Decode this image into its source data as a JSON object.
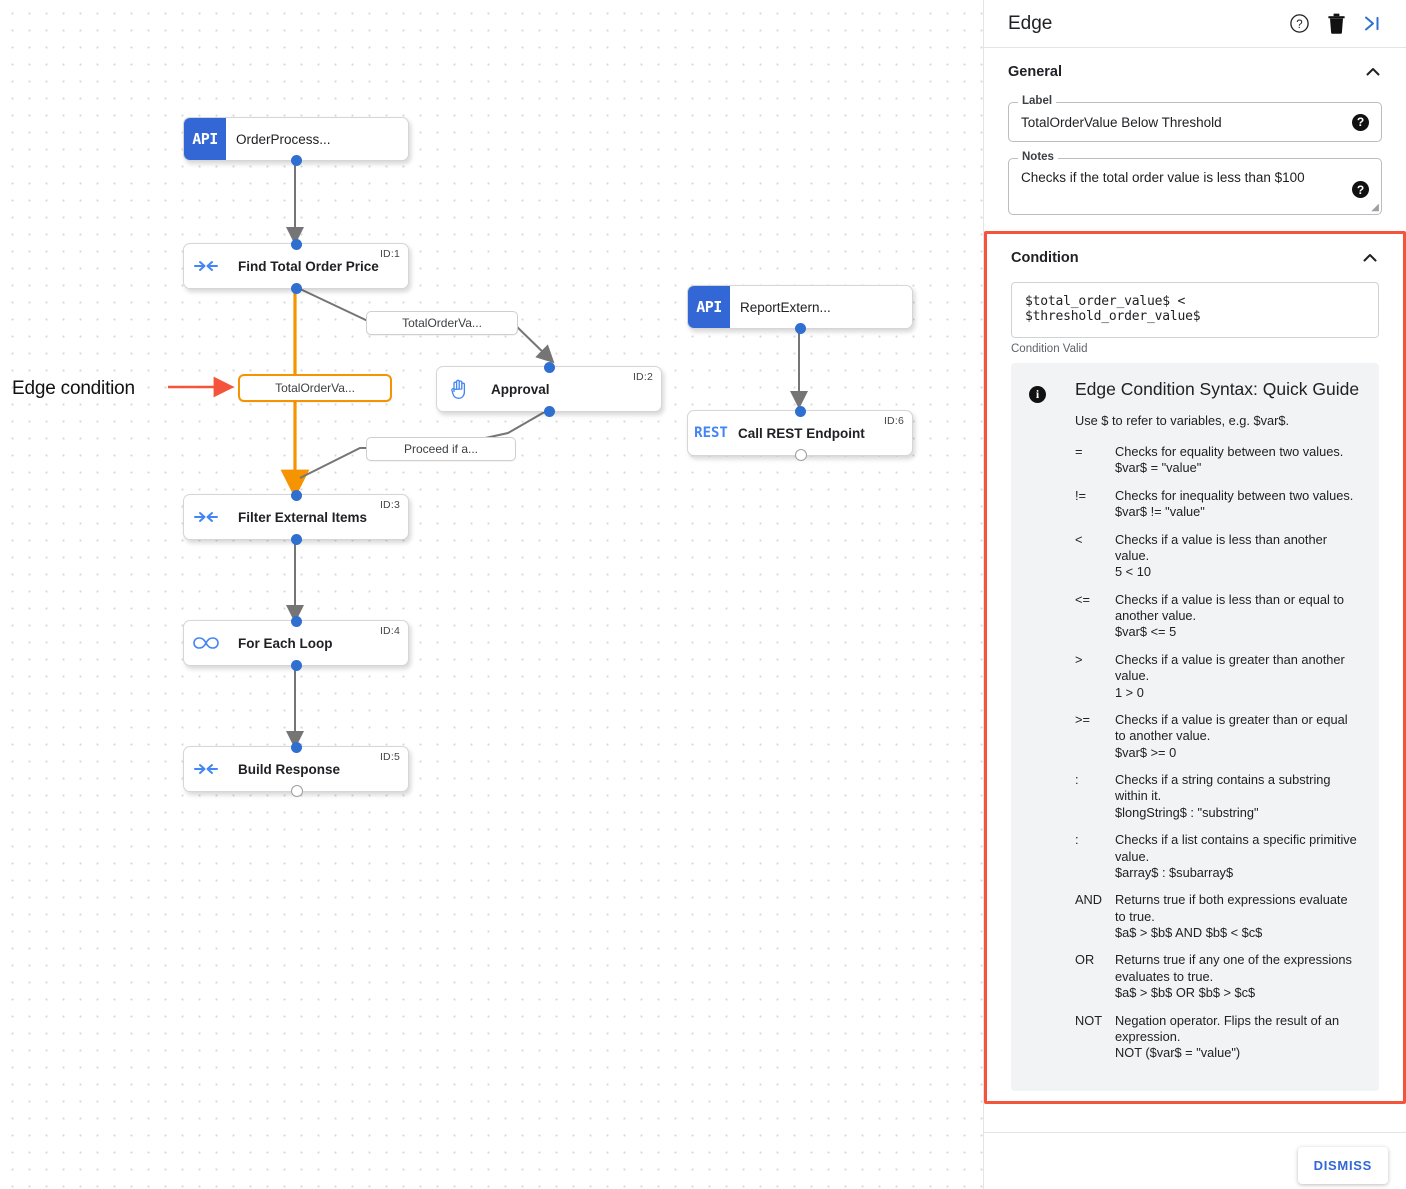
{
  "canvas": {
    "annotation": {
      "label": "Edge condition"
    },
    "nodes": [
      {
        "id": "",
        "badge": "API",
        "label": "OrderProcess...",
        "icon": "api-badge-icon",
        "type": "api"
      },
      {
        "id": "ID:1",
        "badge": "",
        "label": "Find Total Order Price",
        "icon": "merge-arrows-icon",
        "type": "step"
      },
      {
        "id": "ID:2",
        "badge": "",
        "label": "Approval",
        "icon": "hand-icon",
        "type": "step"
      },
      {
        "id": "ID:3",
        "badge": "",
        "label": "Filter External Items",
        "icon": "merge-arrows-icon",
        "type": "step"
      },
      {
        "id": "ID:4",
        "badge": "",
        "label": "For Each Loop",
        "icon": "infinity-icon",
        "type": "step"
      },
      {
        "id": "ID:5",
        "badge": "",
        "label": "Build Response",
        "icon": "merge-arrows-icon",
        "type": "step"
      },
      {
        "id": "",
        "badge": "API",
        "label": "ReportExtern...",
        "icon": "api-badge-icon",
        "type": "api"
      },
      {
        "id": "ID:6",
        "badge": "REST",
        "label": "Call REST Endpoint",
        "icon": "rest-badge-icon",
        "type": "rest"
      }
    ],
    "edge_labels": [
      {
        "text": "TotalOrderVa...",
        "selected": false
      },
      {
        "text": "TotalOrderVa...",
        "selected": true
      },
      {
        "text": "Proceed if a...",
        "selected": false
      }
    ]
  },
  "panel": {
    "title": "Edge",
    "header_icons": [
      "help-circle-icon",
      "trash-icon",
      "collapse-panel-icon"
    ],
    "general": {
      "title": "General",
      "label_field": {
        "legend": "Label",
        "value": "TotalOrderValue Below Threshold"
      },
      "notes_field": {
        "legend": "Notes",
        "value": "Checks if the total order value is less than $100"
      }
    },
    "condition": {
      "title": "Condition",
      "expression": "$total_order_value$ < $threshold_order_value$",
      "validity": "Condition Valid",
      "guide": {
        "title": "Edge Condition Syntax: Quick Guide",
        "intro": "Use $ to refer to variables, e.g. $var$.",
        "operators": [
          {
            "symbol": "=",
            "description": "Checks for equality between two values.",
            "example": "$var$ = \"value\""
          },
          {
            "symbol": "!=",
            "description": "Checks for inequality between two values.",
            "example": "$var$ != \"value\""
          },
          {
            "symbol": "<",
            "description": "Checks if a value is less than another value.",
            "example": "5 < 10"
          },
          {
            "symbol": "<=",
            "description": "Checks if a value is less than or equal to another value.",
            "example": "$var$ <= 5"
          },
          {
            "symbol": ">",
            "description": "Checks if a value is greater than another value.",
            "example": "1 > 0"
          },
          {
            "symbol": ">=",
            "description": "Checks if a value is greater than or equal to another value.",
            "example": "$var$ >= 0"
          },
          {
            "symbol": ":",
            "description": "Checks if a string contains a substring within it.",
            "example": "$longString$ : \"substring\""
          },
          {
            "symbol": ":",
            "description": "Checks if a list contains a specific primitive value.",
            "example": "$array$ : $subarray$"
          },
          {
            "symbol": "AND",
            "description": "Returns true if both expressions evaluate to true.",
            "example": "$a$ > $b$ AND $b$ < $c$"
          },
          {
            "symbol": "OR",
            "description": "Returns true if any one of the expressions evaluates to true.",
            "example": "$a$ > $b$ OR $b$ > $c$"
          },
          {
            "symbol": "NOT",
            "description": "Negation operator. Flips the result of an expression.",
            "example": "NOT ($var$ = \"value\")"
          }
        ]
      }
    },
    "footer": {
      "dismiss_label": "DISMISS"
    }
  },
  "colors": {
    "accent_blue": "#3367d6",
    "highlight_red": "#f4533c",
    "selected_orange": "#f59300",
    "edge_gray": "#757575"
  }
}
